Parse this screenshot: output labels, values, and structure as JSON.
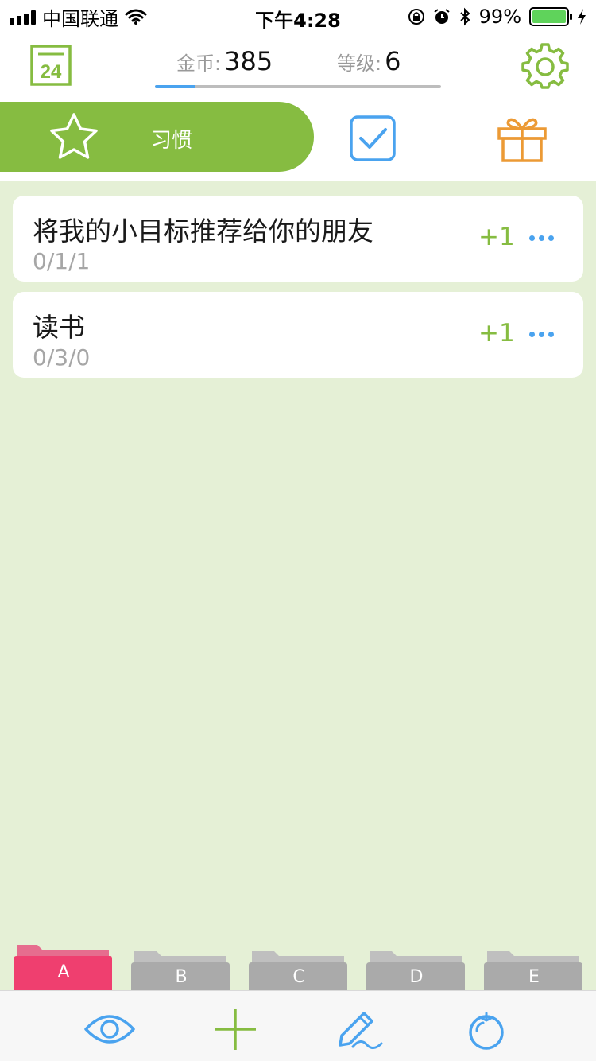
{
  "status_bar": {
    "carrier": "中国联通",
    "time": "下午4:28",
    "battery_pct": "99%",
    "battery_level": 0.99,
    "icons": [
      "signal-icon",
      "wifi-icon",
      "rotation-lock-icon",
      "alarm-icon",
      "bluetooth-icon",
      "battery-icon",
      "charging-icon"
    ]
  },
  "header": {
    "calendar_day": "24",
    "coins_label": "金币:",
    "coins_value": "385",
    "level_label": "等级:",
    "level_value": "6",
    "level_progress": 0.14
  },
  "tabs": {
    "active_label": "习惯",
    "icons": [
      "star-icon",
      "checkbox-icon",
      "gift-icon"
    ]
  },
  "habits": [
    {
      "title": "将我的小目标推荐给你的朋友",
      "meta": "0/1/1",
      "action": "+1"
    },
    {
      "title": "读书",
      "meta": "0/3/0",
      "action": "+1"
    }
  ],
  "folders": [
    {
      "label": "A",
      "active": true
    },
    {
      "label": "B",
      "active": false
    },
    {
      "label": "C",
      "active": false
    },
    {
      "label": "D",
      "active": false
    },
    {
      "label": "E",
      "active": false
    }
  ],
  "toolbar": {
    "icons": [
      "eye-icon",
      "add-icon",
      "edit-icon",
      "tomato-icon"
    ]
  },
  "colors": {
    "accent_green": "#86bc41",
    "accent_blue": "#4aa3ef",
    "accent_orange": "#ec9a35",
    "background": "#e5f0d6",
    "folder_active": "#ef3f6f",
    "folder_inactive": "#aaaaaa"
  }
}
